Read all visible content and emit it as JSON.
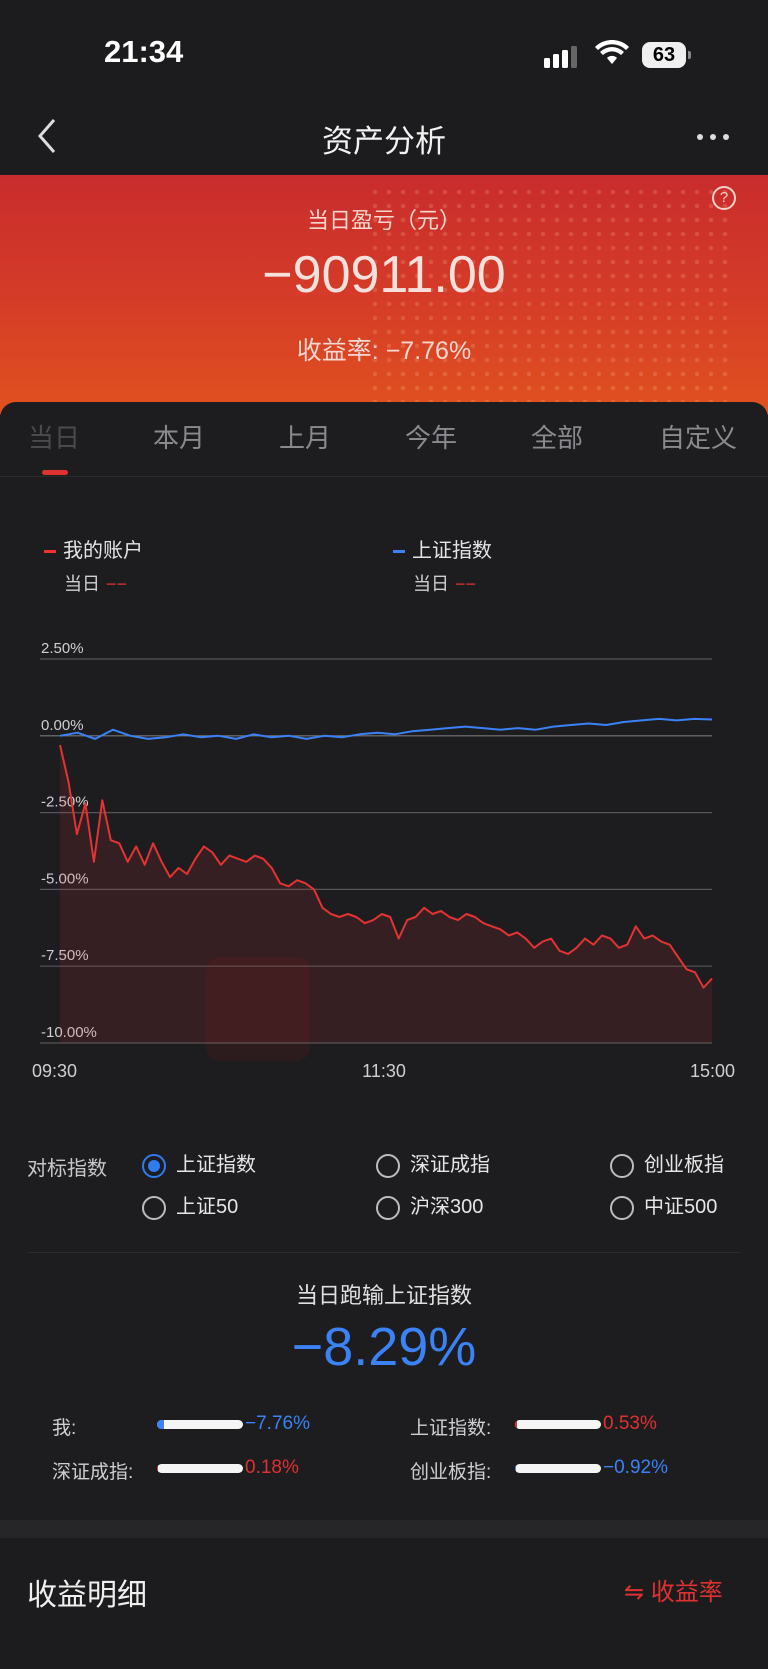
{
  "status": {
    "time": "21:34",
    "battery": "63"
  },
  "nav": {
    "title": "资产分析",
    "back_icon": "chevron-left-icon",
    "more_icon": "more-icon"
  },
  "summary": {
    "label": "当日盈亏（元）",
    "value": "−90911.00",
    "rate_text": "收益率: −7.76%"
  },
  "tabs": [
    "当日",
    "本月",
    "上月",
    "今年",
    "全部",
    "自定义"
  ],
  "legend": {
    "account": {
      "name": "我的账户",
      "sub": "当日",
      "value": "−−"
    },
    "index": {
      "name": "上证指数",
      "sub": "当日",
      "value": "−−"
    }
  },
  "chart_data": {
    "type": "line",
    "x_ticks": [
      "09:30",
      "11:30",
      "15:00"
    ],
    "y_ticks": [
      "2.50%",
      "0.00%",
      "-2.50%",
      "-5.00%",
      "-7.50%",
      "-10.00%"
    ],
    "ylim": [
      -10,
      2.5
    ],
    "grid": true,
    "series": [
      {
        "name": "我的账户",
        "color": "#e33333",
        "values": [
          -0.3,
          -1.5,
          -3.2,
          -2.2,
          -4.1,
          -2.1,
          -3.4,
          -3.5,
          -4.1,
          -3.6,
          -4.2,
          -3.5,
          -4.1,
          -4.6,
          -4.3,
          -4.5,
          -4.0,
          -3.6,
          -3.8,
          -4.2,
          -3.9,
          -4.0,
          -4.1,
          -3.9,
          -4.0,
          -4.3,
          -4.8,
          -4.9,
          -4.7,
          -4.8,
          -5.0,
          -5.6,
          -5.8,
          -5.9,
          -5.8,
          -5.9,
          -6.1,
          -6.0,
          -5.8,
          -5.9,
          -6.6,
          -6.0,
          -5.9,
          -5.6,
          -5.8,
          -5.7,
          -5.9,
          -6.0,
          -5.8,
          -5.9,
          -6.1,
          -6.2,
          -6.3,
          -6.5,
          -6.4,
          -6.6,
          -6.9,
          -6.7,
          -6.6,
          -7.0,
          -7.1,
          -6.9,
          -6.6,
          -6.8,
          -6.5,
          -6.6,
          -6.9,
          -6.8,
          -6.2,
          -6.6,
          -6.5,
          -6.7,
          -6.8,
          -7.2,
          -7.6,
          -7.7,
          -8.2,
          -7.9
        ]
      },
      {
        "name": "上证指数",
        "color": "#3b82f6",
        "values": [
          0.0,
          0.1,
          -0.1,
          0.2,
          0.0,
          -0.1,
          -0.05,
          0.05,
          -0.05,
          0.0,
          -0.1,
          0.05,
          -0.05,
          0.0,
          -0.1,
          0.0,
          -0.05,
          0.05,
          0.1,
          0.05,
          0.15,
          0.2,
          0.25,
          0.3,
          0.25,
          0.2,
          0.25,
          0.2,
          0.3,
          0.35,
          0.4,
          0.35,
          0.45,
          0.5,
          0.55,
          0.5,
          0.55,
          0.53
        ]
      }
    ]
  },
  "benchmark": {
    "label": "对标指数",
    "options": [
      {
        "label": "上证指数",
        "selected": true
      },
      {
        "label": "深证成指",
        "selected": false
      },
      {
        "label": "创业板指",
        "selected": false
      },
      {
        "label": "上证50",
        "selected": false
      },
      {
        "label": "沪深300",
        "selected": false
      },
      {
        "label": "中证500",
        "selected": false
      }
    ]
  },
  "comparison": {
    "title": "当日跑输上证指数",
    "value": "−8.29%",
    "rows": [
      {
        "label": "我:",
        "value": "−7.76%",
        "direction": "down",
        "level": 0.08
      },
      {
        "label": "上证指数:",
        "value": "0.53%",
        "direction": "up",
        "level": 0.02
      },
      {
        "label": "深证成指:",
        "value": "0.18%",
        "direction": "up",
        "level": 0.01
      },
      {
        "label": "创业板指:",
        "value": "−0.92%",
        "direction": "down",
        "level": 0.01
      }
    ]
  },
  "details": {
    "title": "收益明细",
    "toggle_label": "⇋ 收益率"
  }
}
